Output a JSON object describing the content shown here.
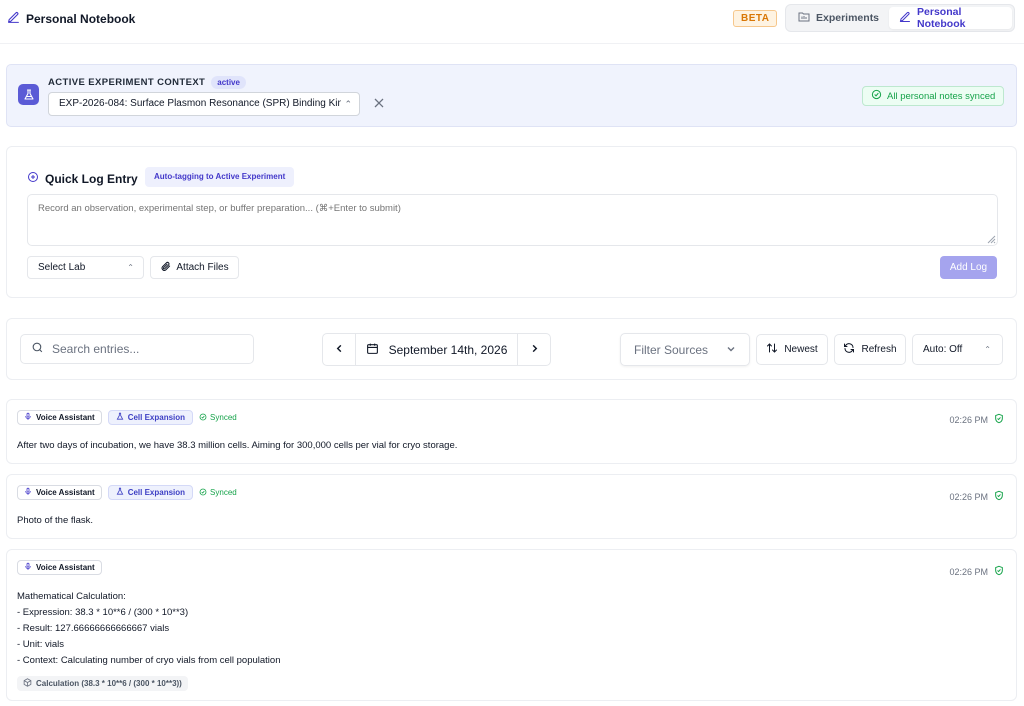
{
  "header": {
    "title": "Personal Notebook",
    "beta": "BETA",
    "views": [
      {
        "label": "Experiments",
        "icon": "folder-icon"
      },
      {
        "label": "Personal Notebook",
        "icon": "pencil-icon"
      }
    ]
  },
  "context": {
    "label": "ACTIVE EXPERIMENT CONTEXT",
    "status": "active",
    "experiment": "EXP-2026-084: Surface Plasmon Resonance (SPR) Binding Kinetics",
    "sync_status": "All personal notes synced"
  },
  "quick_log": {
    "title": "Quick Log Entry",
    "tag_pill": "Auto-tagging to Active Experiment",
    "placeholder": "Record an observation, experimental step, or buffer preparation... (⌘+Enter to submit)",
    "lab_select": "Select Lab",
    "attach_label": "Attach Files",
    "submit_label": "Add Log"
  },
  "toolbar": {
    "search_placeholder": "Search entries...",
    "date": "September 14th, 2026",
    "filter_label": "Filter Sources",
    "sort_label": "Newest",
    "refresh_label": "Refresh",
    "auto_label": "Auto: Off"
  },
  "entries": [
    {
      "source": "Voice Assistant",
      "experiment": "Cell Expansion",
      "synced": "Synced",
      "time": "02:26 PM",
      "text": "After two days of incubation, we have 38.3 million cells. Aiming for 300,000 cells per vial for cryo storage."
    },
    {
      "source": "Voice Assistant",
      "experiment": "Cell Expansion",
      "synced": "Synced",
      "time": "02:26 PM",
      "text": "Photo of the flask."
    },
    {
      "source": "Voice Assistant",
      "time": "02:26 PM",
      "lines": [
        "Mathematical Calculation:",
        "- Expression: 38.3 * 10**6 / (300 * 10**3)",
        "- Result: 127.66666666666667 vials",
        "- Unit: vials",
        "- Context: Calculating number of cryo vials from cell population"
      ],
      "calc_tag": "Calculation (38.3 * 10**6 / (300 * 10**3))"
    }
  ],
  "colors": {
    "accent": "#4338ca",
    "accent_solid": "#5b5bd6",
    "success": "#16a34a",
    "warning": "#d97706"
  }
}
